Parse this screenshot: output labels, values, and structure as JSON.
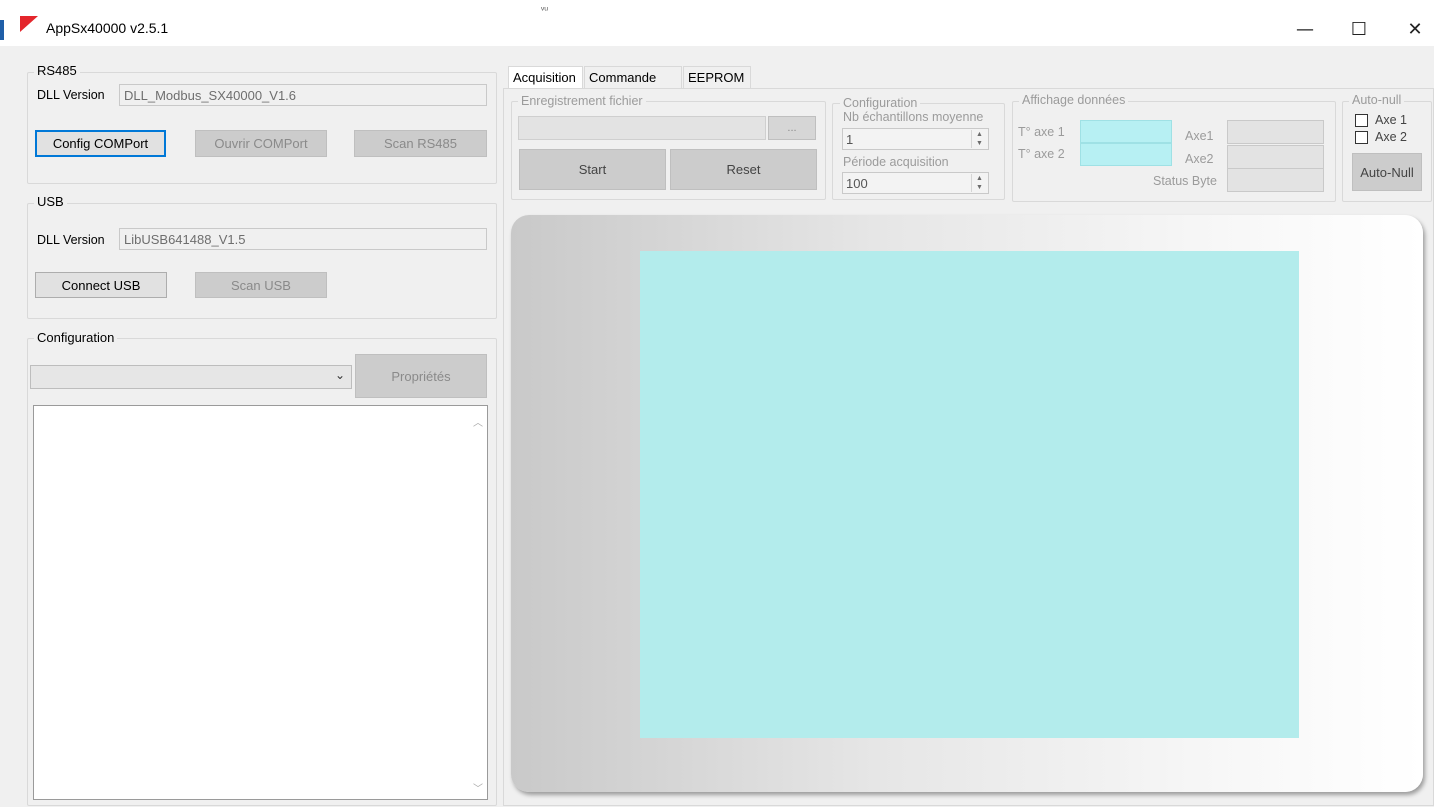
{
  "window": {
    "title": "AppSx40000 v2.5.1",
    "stray_mark": "ᵥᵤ",
    "minimize_icon": "—",
    "maximize_icon": "☐",
    "close_icon": "✕"
  },
  "rs485": {
    "legend": "RS485",
    "dll_label": "DLL Version",
    "dll_value": "DLL_Modbus_SX40000_V1.6",
    "config_button": "Config COMPort",
    "open_button": "Ouvrir COMPort",
    "scan_button": "Scan RS485"
  },
  "usb": {
    "legend": "USB",
    "dll_label": "DLL Version",
    "dll_value": "LibUSB641488_V1.5",
    "connect_button": "Connect USB",
    "scan_button": "Scan USB"
  },
  "configuration": {
    "legend": "Configuration",
    "select_value": "",
    "properties_button": "Propriétés"
  },
  "tabs": [
    {
      "label": "Acquisition"
    },
    {
      "label": "Commande RS"
    },
    {
      "label": "EEPROM"
    }
  ],
  "recording": {
    "legend": "Enregistrement fichier",
    "file_value": "",
    "browse_button": "...",
    "start_button": "Start",
    "reset_button": "Reset"
  },
  "acq_config": {
    "legend": "Configuration",
    "samples_label": "Nb échantillons moyenne",
    "samples_value": "1",
    "period_label": "Période acquisition",
    "period_value": "100"
  },
  "display": {
    "legend": "Affichage données",
    "temp1_label": "T° axe 1",
    "temp2_label": "T° axe 2",
    "axe1_label": "Axe1",
    "axe2_label": "Axe2",
    "status_label": "Status Byte"
  },
  "autonull": {
    "legend": "Auto-null",
    "axe1_label": "Axe 1",
    "axe2_label": "Axe 2",
    "button": "Auto-Null"
  },
  "colors": {
    "accent": "#0078d7",
    "logo": "#e4262c",
    "plot_area": "#b3ecec"
  }
}
